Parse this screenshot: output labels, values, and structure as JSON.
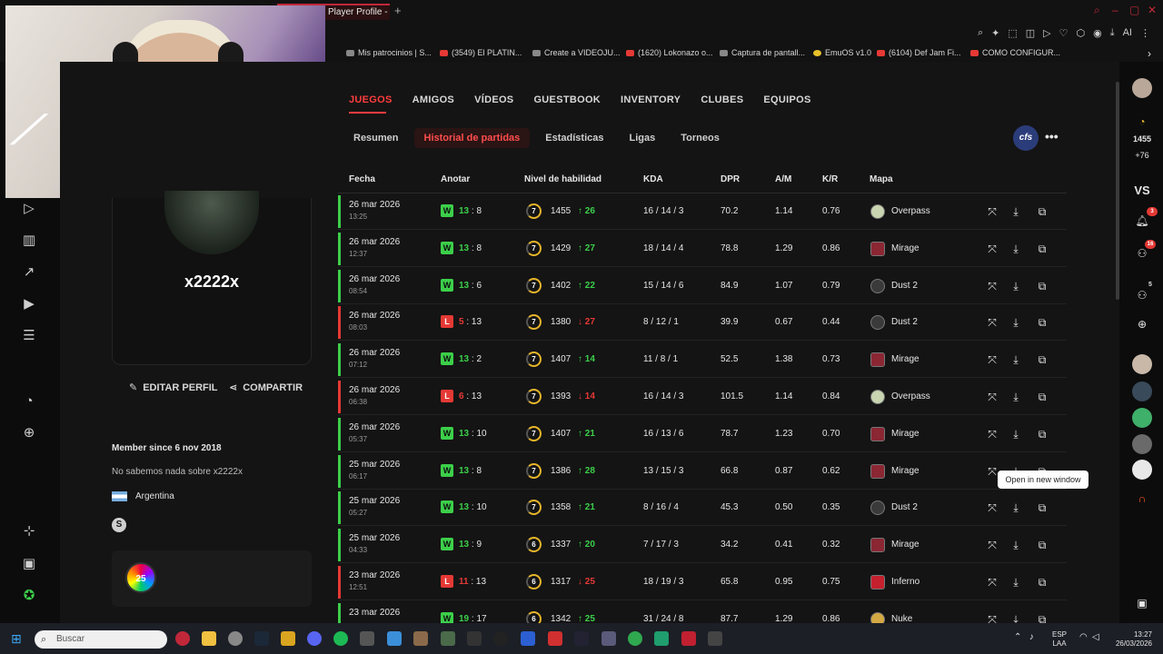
{
  "browser": {
    "tab_title": "Player Profile - F",
    "new_tab": "+",
    "tools_ai": "AI",
    "bookmarks": [
      {
        "label": "Mis patrocinios | S...",
        "icon": "page-icon"
      },
      {
        "label": "(3549) El PLATIN...",
        "icon": "youtube-icon"
      },
      {
        "label": "Create a VIDEOJU...",
        "icon": "page-icon"
      },
      {
        "label": "(1620) Lokonazo o...",
        "icon": "youtube-icon"
      },
      {
        "label": "Captura de pantall...",
        "icon": "page-icon"
      },
      {
        "label": "EmuOS v1.0",
        "icon": "emuos-icon"
      },
      {
        "label": "(6104) Def Jam Fi...",
        "icon": "youtube-icon"
      },
      {
        "label": "COMO CONFIGUR...",
        "icon": "youtube-icon"
      }
    ]
  },
  "profile": {
    "username": "x2222x",
    "edit_label": "EDITAR PERFIL",
    "share_label": "COMPARTIR",
    "member_since": "Member since 6 nov 2018",
    "about": "No sabemos nada sobre x2222x",
    "country": "Argentina",
    "badge_text": "25"
  },
  "tabs": [
    "JUEGOS",
    "AMIGOS",
    "VÍDEOS",
    "GUESTBOOK",
    "INVENTORY",
    "CLUBES",
    "EQUIPOS"
  ],
  "subtabs": [
    "Resumen",
    "Historial de partidas",
    "Estadísticas",
    "Ligas",
    "Torneos"
  ],
  "org_badge": "cfs",
  "columns": {
    "fecha": "Fecha",
    "anotar": "Anotar",
    "nivel": "Nivel de habilidad",
    "kda": "KDA",
    "dpr": "DPR",
    "am": "A/M",
    "kr": "K/R",
    "mapa": "Mapa"
  },
  "matches": [
    {
      "date": "26 mar 2026",
      "time": "13:25",
      "result": "W",
      "win_score": "13",
      "lose_score": "8",
      "level": "7",
      "elo": "1455",
      "delta": "26",
      "dir": "up",
      "kda": "16 / 14 / 3",
      "dpr": "70.2",
      "am": "1.14",
      "kr": "0.76",
      "map": "Overpass",
      "map_key": "overpass"
    },
    {
      "date": "26 mar 2026",
      "time": "12:37",
      "result": "W",
      "win_score": "13",
      "lose_score": "8",
      "level": "7",
      "elo": "1429",
      "delta": "27",
      "dir": "up",
      "kda": "18 / 14 / 4",
      "dpr": "78.8",
      "am": "1.29",
      "kr": "0.86",
      "map": "Mirage",
      "map_key": "mirage"
    },
    {
      "date": "26 mar 2026",
      "time": "08:54",
      "result": "W",
      "win_score": "13",
      "lose_score": "6",
      "level": "7",
      "elo": "1402",
      "delta": "22",
      "dir": "up",
      "kda": "15 / 14 / 6",
      "dpr": "84.9",
      "am": "1.07",
      "kr": "0.79",
      "map": "Dust 2",
      "map_key": "dust2"
    },
    {
      "date": "26 mar 2026",
      "time": "08:03",
      "result": "L",
      "win_score": "5",
      "lose_score": "13",
      "level": "7",
      "elo": "1380",
      "delta": "27",
      "dir": "down",
      "kda": "8 / 12 / 1",
      "dpr": "39.9",
      "am": "0.67",
      "kr": "0.44",
      "map": "Dust 2",
      "map_key": "dust2"
    },
    {
      "date": "26 mar 2026",
      "time": "07:12",
      "result": "W",
      "win_score": "13",
      "lose_score": "2",
      "level": "7",
      "elo": "1407",
      "delta": "14",
      "dir": "up",
      "kda": "11 / 8 / 1",
      "dpr": "52.5",
      "am": "1.38",
      "kr": "0.73",
      "map": "Mirage",
      "map_key": "mirage"
    },
    {
      "date": "26 mar 2026",
      "time": "06:38",
      "result": "L",
      "win_score": "6",
      "lose_score": "13",
      "level": "7",
      "elo": "1393",
      "delta": "14",
      "dir": "down",
      "kda": "16 / 14 / 3",
      "dpr": "101.5",
      "am": "1.14",
      "kr": "0.84",
      "map": "Overpass",
      "map_key": "overpass"
    },
    {
      "date": "26 mar 2026",
      "time": "05:37",
      "result": "W",
      "win_score": "13",
      "lose_score": "10",
      "level": "7",
      "elo": "1407",
      "delta": "21",
      "dir": "up",
      "kda": "16 / 13 / 6",
      "dpr": "78.7",
      "am": "1.23",
      "kr": "0.70",
      "map": "Mirage",
      "map_key": "mirage"
    },
    {
      "date": "25 mar 2026",
      "time": "06:17",
      "result": "W",
      "win_score": "13",
      "lose_score": "8",
      "level": "7",
      "elo": "1386",
      "delta": "28",
      "dir": "up",
      "kda": "13 / 15 / 3",
      "dpr": "66.8",
      "am": "0.87",
      "kr": "0.62",
      "map": "Mirage",
      "map_key": "mirage"
    },
    {
      "date": "25 mar 2026",
      "time": "05:27",
      "result": "W",
      "win_score": "13",
      "lose_score": "10",
      "level": "7",
      "elo": "1358",
      "delta": "21",
      "dir": "up",
      "kda": "8 / 16 / 4",
      "dpr": "45.3",
      "am": "0.50",
      "kr": "0.35",
      "map": "Dust 2",
      "map_key": "dust2"
    },
    {
      "date": "25 mar 2026",
      "time": "04:33",
      "result": "W",
      "win_score": "13",
      "lose_score": "9",
      "level": "6",
      "elo": "1337",
      "delta": "20",
      "dir": "up",
      "kda": "7 / 17 / 3",
      "dpr": "34.2",
      "am": "0.41",
      "kr": "0.32",
      "map": "Mirage",
      "map_key": "mirage"
    },
    {
      "date": "23 mar 2026",
      "time": "12:51",
      "result": "L",
      "win_score": "11",
      "lose_score": "13",
      "level": "6",
      "elo": "1317",
      "delta": "25",
      "dir": "down",
      "kda": "18 / 19 / 3",
      "dpr": "65.8",
      "am": "0.95",
      "kr": "0.75",
      "map": "Inferno",
      "map_key": "inferno"
    },
    {
      "date": "23 mar 2026",
      "time": "",
      "result": "W",
      "win_score": "19",
      "lose_score": "17",
      "level": "6",
      "elo": "1342",
      "delta": "25",
      "dir": "up",
      "kda": "31 / 24 / 8",
      "dpr": "87.7",
      "am": "1.29",
      "kr": "0.86",
      "map": "Nuke",
      "map_key": "nuke"
    }
  ],
  "tooltip": "Open in new window",
  "right_sidebar": {
    "elo": "1455",
    "elo_delta": "+76",
    "vs": "VS",
    "notif_count": "3",
    "friends_count": "16",
    "queue_count": "5"
  },
  "taskbar": {
    "search_placeholder": "Buscar",
    "lang_line1": "ESP",
    "lang_line2": "LAA",
    "time": "13:27",
    "date": "26/03/2026"
  },
  "colors": {
    "accent": "#ff3d3d",
    "win": "#3ccf4a",
    "loss": "#e53935",
    "panel": "#141414"
  }
}
